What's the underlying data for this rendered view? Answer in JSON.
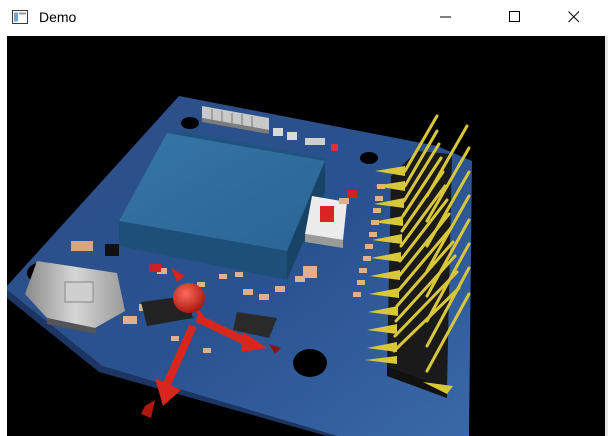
{
  "window": {
    "title": "Demo",
    "controls": {
      "minimize": "minimize",
      "maximize": "maximize",
      "close": "close"
    }
  },
  "viewport": {
    "background": "#000000",
    "board_color": "#2a4f8a",
    "module_color": "#2f6f9e",
    "pin_color": "#d8c23a",
    "gizmo_color": "#d9261c"
  }
}
